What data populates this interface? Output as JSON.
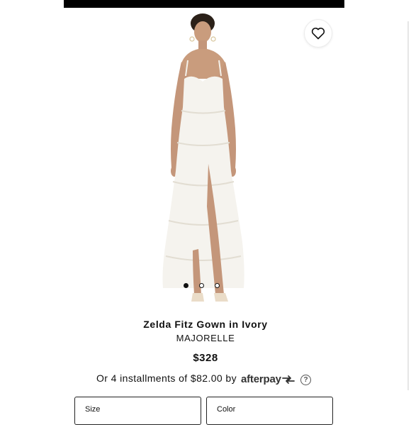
{
  "product": {
    "image_alt": "Model wearing white lace tiered gown",
    "title": "Zelda Fitz Gown in Ivory",
    "brand": "MAJORELLE",
    "price": "$328",
    "installments_text": "Or 4 installments of $82.00 by",
    "afterpay_label": "afterpay",
    "info_label": "?"
  },
  "gallery": {
    "total": 3,
    "active": 1
  },
  "icons": {
    "wishlist": "heart-outline-icon",
    "afterpay": "afterpay-arrows-icon",
    "info": "question-circle-icon"
  },
  "selectors": {
    "size_label": "Size",
    "color_label": "Color"
  },
  "colors": {
    "text": "#111111",
    "border": "#222222",
    "topbar": "#000000"
  }
}
